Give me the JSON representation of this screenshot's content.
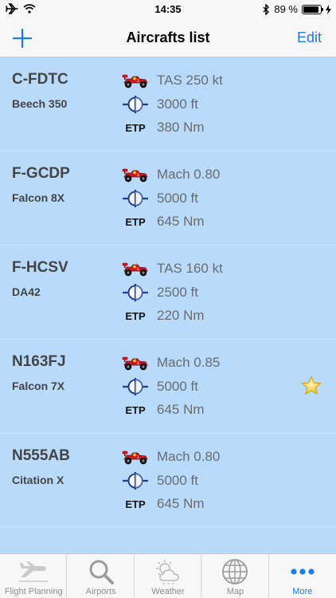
{
  "status": {
    "time": "14:35",
    "battery": "89 %",
    "battery_level": 0.89
  },
  "nav": {
    "title": "Aircrafts list",
    "edit_label": "Edit",
    "add_icon": "plus-icon"
  },
  "aircraft": [
    {
      "registration": "C-FDTC",
      "model": "Beech 350",
      "speed": "TAS 250 kt",
      "altitude": "3000 ft",
      "etp_label": "ETP",
      "etp": "380 Nm",
      "favorite": false
    },
    {
      "registration": "F-GCDP",
      "model": "Falcon 8X",
      "speed": "Mach 0.80",
      "altitude": "5000 ft",
      "etp_label": "ETP",
      "etp": "645 Nm",
      "favorite": false
    },
    {
      "registration": "F-HCSV",
      "model": "DA42",
      "speed": "TAS 160 kt",
      "altitude": "2500 ft",
      "etp_label": "ETP",
      "etp": "220 Nm",
      "favorite": false
    },
    {
      "registration": "N163FJ",
      "model": "Falcon 7X",
      "speed": "Mach 0.85",
      "altitude": "5000 ft",
      "etp_label": "ETP",
      "etp": "645 Nm",
      "favorite": true
    },
    {
      "registration": "N555AB",
      "model": "Citation X",
      "speed": "Mach 0.80",
      "altitude": "5000 ft",
      "etp_label": "ETP",
      "etp": "645 Nm",
      "favorite": false
    }
  ],
  "tabs": [
    {
      "label": "Flight Planning",
      "icon": "airplane-icon",
      "active": false
    },
    {
      "label": "Airports",
      "icon": "search-icon",
      "active": false
    },
    {
      "label": "Weather",
      "icon": "weather-icon",
      "active": false
    },
    {
      "label": "Map",
      "icon": "globe-icon",
      "active": false
    },
    {
      "label": "More",
      "icon": "more-icon",
      "active": true
    }
  ],
  "colors": {
    "accent": "#1a7cf4",
    "list_background": "#b9dbfb",
    "bar_background": "#f7f7f7"
  }
}
